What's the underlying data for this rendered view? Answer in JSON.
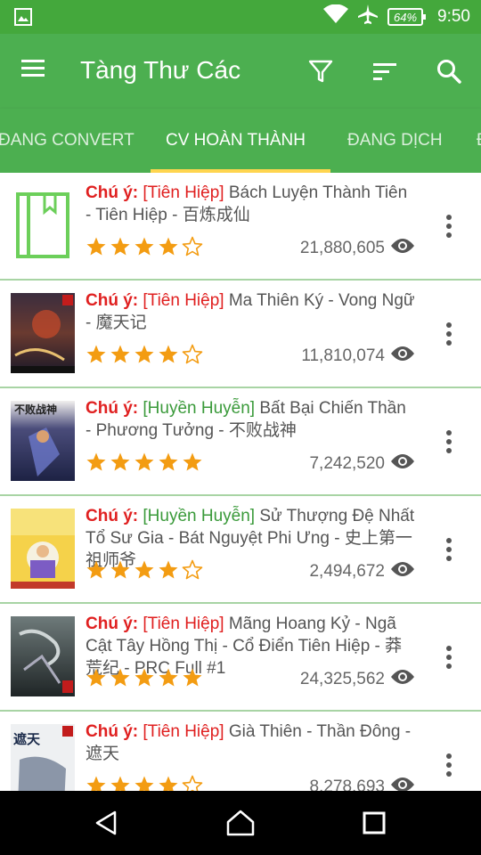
{
  "status_bar": {
    "battery": "64%",
    "time": "9:50",
    "icons": [
      "image-icon",
      "wifi-icon",
      "airplane-icon",
      "battery-icon"
    ]
  },
  "app_bar": {
    "title": "Tàng Thư Các",
    "actions": [
      "filter-icon",
      "sort-icon",
      "search-icon"
    ]
  },
  "tabs": [
    {
      "label": "ĐANG CONVERT",
      "active": false
    },
    {
      "label": "CV HOÀN THÀNH",
      "active": true
    },
    {
      "label": "ĐANG DỊCH",
      "active": false
    }
  ],
  "colors": {
    "primary": "#4caf50",
    "status_bar": "#44a83c",
    "indicator": "#ffd54f",
    "note_red": "#e02020",
    "category_green": "#3a9a3a",
    "star": "#f39c12"
  },
  "books": [
    {
      "note": "Chú ý:",
      "category": "[Tiên Hiệp]",
      "category_color": "red",
      "title": " Bách Luyện Thành Tiên - Tiên Hiệp - 百炼成仙",
      "rating": 4,
      "views": "21,880,605",
      "cover": "placeholder"
    },
    {
      "note": "Chú ý:",
      "category": "[Tiên Hiệp]",
      "category_color": "red",
      "title": " Ma Thiên Ký - Vong Ngữ - 魔天记",
      "rating": 4,
      "views": "11,810,074",
      "cover": "art-dark"
    },
    {
      "note": "Chú ý:",
      "category": "[Huyền Huyễn]",
      "category_color": "green",
      "title": " Bất Bại Chiến Thần - Phương Tưởng - 不败战神",
      "rating": 5,
      "views": "7,242,520",
      "cover": "art-blue"
    },
    {
      "note": "Chú ý:",
      "category": "[Huyền Huyễn]",
      "category_color": "green",
      "title": " Sử Thượng Đệ Nhất Tổ Sư Gia - Bát Nguyệt Phi Ưng - 史上第一祖师爷",
      "rating": 4,
      "views": "2,494,672",
      "cover": "art-yellow"
    },
    {
      "note": "Chú ý:",
      "category": "[Tiên Hiệp]",
      "category_color": "red",
      "title": " Mãng Hoang Kỷ - Ngã Cật Tây Hồng Thị - Cổ Điển Tiên Hiệp - 莽荒纪 - PRC Full #1",
      "rating": 5,
      "views": "24,325,562",
      "cover": "art-grey"
    },
    {
      "note": "Chú ý:",
      "category": "[Tiên Hiệp]",
      "category_color": "red",
      "title": " Già Thiên - Thần Đông - 遮天",
      "rating": 4,
      "views": "8,278,693",
      "cover": "art-white"
    }
  ],
  "nav_bar": {
    "buttons": [
      "back-icon",
      "home-icon",
      "recents-icon"
    ]
  }
}
